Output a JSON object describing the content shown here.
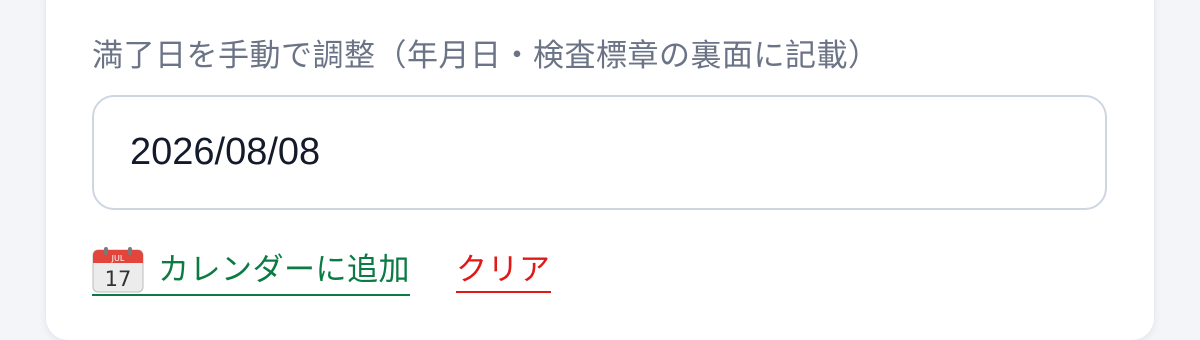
{
  "field": {
    "label": "満了日を手動で調整（年月日・検査標章の裏面に記載）",
    "value": "2026/08/08"
  },
  "actions": {
    "add_calendar_label": "カレンダーに追加",
    "add_calendar_icon": "calendar-icon",
    "calendar_icon_month": "JUL",
    "calendar_icon_day": "17",
    "clear_label": "クリア"
  },
  "colors": {
    "add_calendar": "#0b7a43",
    "clear": "#e01818",
    "label": "#6b7486"
  }
}
